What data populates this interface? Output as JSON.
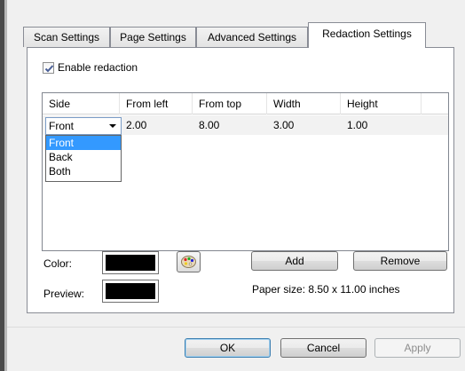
{
  "tabs": [
    {
      "label": "Scan Settings"
    },
    {
      "label": "Page Settings"
    },
    {
      "label": "Advanced Settings"
    },
    {
      "label": "Redaction Settings",
      "active": true
    }
  ],
  "enable_redaction": {
    "label": "Enable redaction",
    "checked": true
  },
  "table": {
    "columns": [
      "Side",
      "From left",
      "From top",
      "Width",
      "Height"
    ],
    "rows": [
      {
        "side": "Front",
        "from_left": "2.00",
        "from_top": "8.00",
        "width": "3.00",
        "height": "1.00"
      }
    ]
  },
  "side_dropdown": {
    "selected": "Front",
    "options": [
      "Front",
      "Back",
      "Both"
    ]
  },
  "color": {
    "label": "Color:",
    "value": "#000000"
  },
  "preview": {
    "label": "Preview:",
    "value": "#000000"
  },
  "buttons": {
    "add": "Add",
    "remove": "Remove",
    "ok": "OK",
    "cancel": "Cancel",
    "apply": "Apply"
  },
  "paper_size": "Paper size:  8.50 x 11.00 inches",
  "icons": {
    "palette": "palette-icon",
    "checkmark": "checkmark-icon"
  }
}
